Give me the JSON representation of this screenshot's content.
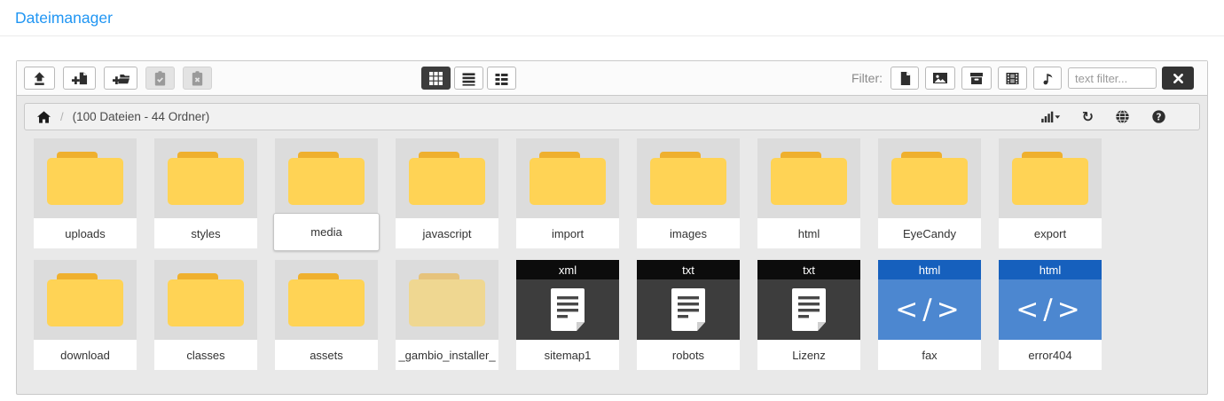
{
  "page": {
    "title": "Dateimanager"
  },
  "toolbar": {
    "actions": [
      {
        "name": "upload",
        "icon": "upload-icon",
        "enabled": true
      },
      {
        "name": "new-file",
        "icon": "file-plus-icon",
        "enabled": true
      },
      {
        "name": "new-folder",
        "icon": "folder-plus-icon",
        "enabled": true
      },
      {
        "name": "paste-clipboard",
        "icon": "clipboard-check-icon",
        "enabled": false
      },
      {
        "name": "clear-clipboard",
        "icon": "clipboard-x-icon",
        "enabled": false
      }
    ],
    "views": [
      {
        "name": "grid-view",
        "icon": "grid-icon",
        "active": true
      },
      {
        "name": "list-view",
        "icon": "list-icon",
        "active": false
      },
      {
        "name": "details-view",
        "icon": "details-icon",
        "active": false
      }
    ]
  },
  "filter": {
    "label": "Filter:",
    "type_buttons": [
      {
        "name": "filter-files",
        "icon": "file-icon"
      },
      {
        "name": "filter-images",
        "icon": "image-icon"
      },
      {
        "name": "filter-archives",
        "icon": "archive-icon"
      },
      {
        "name": "filter-videos",
        "icon": "film-icon"
      },
      {
        "name": "filter-audio",
        "icon": "music-icon"
      }
    ],
    "input_placeholder": "text filter...",
    "clear_icon": "close-icon"
  },
  "breadcrumb": {
    "home_icon": "home-icon",
    "separator": "/",
    "status": "(100 Dateien - 44 Ordner)",
    "actions": [
      {
        "name": "sort",
        "icon": "sort-bars-icon"
      },
      {
        "name": "refresh",
        "icon": "refresh-icon"
      },
      {
        "name": "language",
        "icon": "globe-icon"
      },
      {
        "name": "help",
        "icon": "help-icon"
      }
    ]
  },
  "items": [
    {
      "name": "uploads",
      "type": "folder"
    },
    {
      "name": "styles",
      "type": "folder"
    },
    {
      "name": "media",
      "type": "folder",
      "editing": true
    },
    {
      "name": "javascript",
      "type": "folder"
    },
    {
      "name": "import",
      "type": "folder"
    },
    {
      "name": "images",
      "type": "folder"
    },
    {
      "name": "html",
      "type": "folder"
    },
    {
      "name": "EyeCandy",
      "type": "folder"
    },
    {
      "name": "export",
      "type": "folder"
    },
    {
      "name": "download",
      "type": "folder"
    },
    {
      "name": "classes",
      "type": "folder"
    },
    {
      "name": "assets",
      "type": "folder"
    },
    {
      "name": "_gambio_installer_",
      "type": "folder",
      "muted": true
    },
    {
      "name": "sitemap1",
      "type": "file",
      "ext": "xml",
      "variant": "dark",
      "icon": "document-icon"
    },
    {
      "name": "robots",
      "type": "file",
      "ext": "txt",
      "variant": "dark",
      "icon": "document-icon"
    },
    {
      "name": "Lizenz",
      "type": "file",
      "ext": "txt",
      "variant": "dark",
      "icon": "document-icon"
    },
    {
      "name": "fax",
      "type": "file",
      "ext": "html",
      "variant": "code",
      "icon": "code-icon",
      "glyph": "</>"
    },
    {
      "name": "error404",
      "type": "file",
      "ext": "html",
      "variant": "code",
      "icon": "code-icon",
      "glyph": "</>"
    }
  ],
  "colors": {
    "accent": "#2196f3",
    "folder_body": "#ffd355",
    "folder_tab": "#efb02e",
    "file_dark_header": "#0c0c0c",
    "file_dark_body": "#3d3d3d",
    "file_html_header": "#1660bd",
    "file_html_body": "#4c87d0",
    "toolbar_active": "#3c3c3c"
  }
}
